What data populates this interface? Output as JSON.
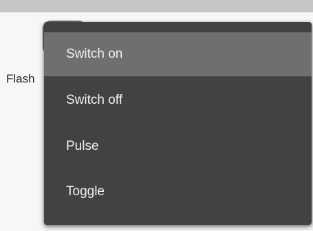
{
  "form": {
    "flash_label": "Flash"
  },
  "menu": {
    "items": [
      {
        "label": "Switch on",
        "selected": true
      },
      {
        "label": "Switch off",
        "selected": false
      },
      {
        "label": "Pulse",
        "selected": false
      },
      {
        "label": "Toggle",
        "selected": false
      }
    ]
  },
  "colors": {
    "menu_background": "#424242",
    "menu_selected_background": "#6f6f6f",
    "menu_text": "#f2f2f2",
    "page_background": "#f7f7f7",
    "top_bar": "#c6c6c6"
  }
}
